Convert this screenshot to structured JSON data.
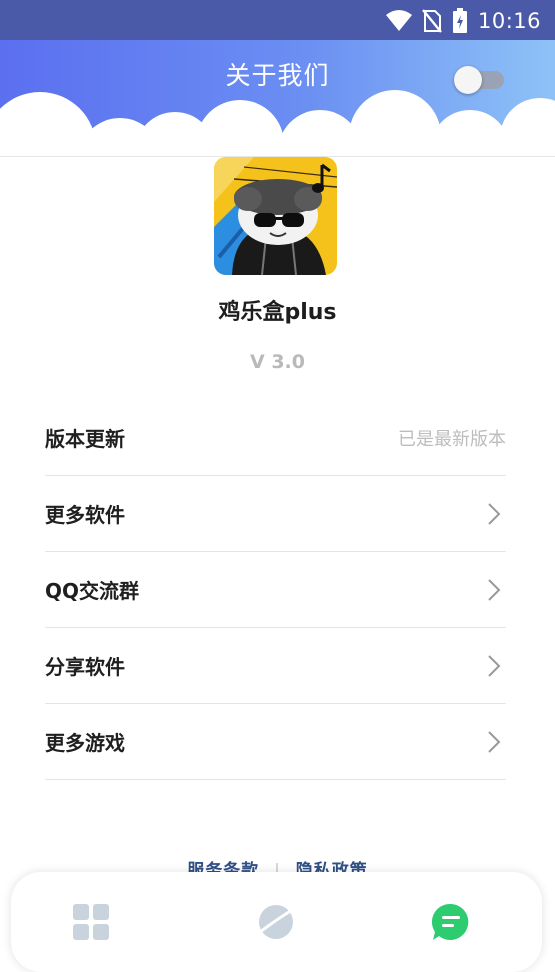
{
  "status_bar": {
    "time": "10:16",
    "icons": [
      "wifi-icon",
      "no-sim-icon",
      "battery-icon"
    ]
  },
  "header": {
    "title": "关于我们",
    "toggle_state": "off",
    "gradient": [
      "#5b6ff0",
      "#8ec2f7"
    ]
  },
  "app": {
    "name": "鸡乐盒plus",
    "version": "V 3.0",
    "icon": "panda-sunglasses-app-icon"
  },
  "menu": [
    {
      "label": "版本更新",
      "value": "已是最新版本"
    },
    {
      "label": "更多软件",
      "value": ""
    },
    {
      "label": "QQ交流群",
      "value": ""
    },
    {
      "label": "分享软件",
      "value": ""
    },
    {
      "label": "更多游戏",
      "value": ""
    }
  ],
  "footer": {
    "terms": "服务条款",
    "separator": "|",
    "privacy": "隐私政策"
  },
  "bottom_nav": {
    "items": [
      "apps-grid-icon",
      "planet-icon",
      "chat-icon"
    ],
    "active": "chat-icon",
    "active_color": "#2ecc71"
  }
}
